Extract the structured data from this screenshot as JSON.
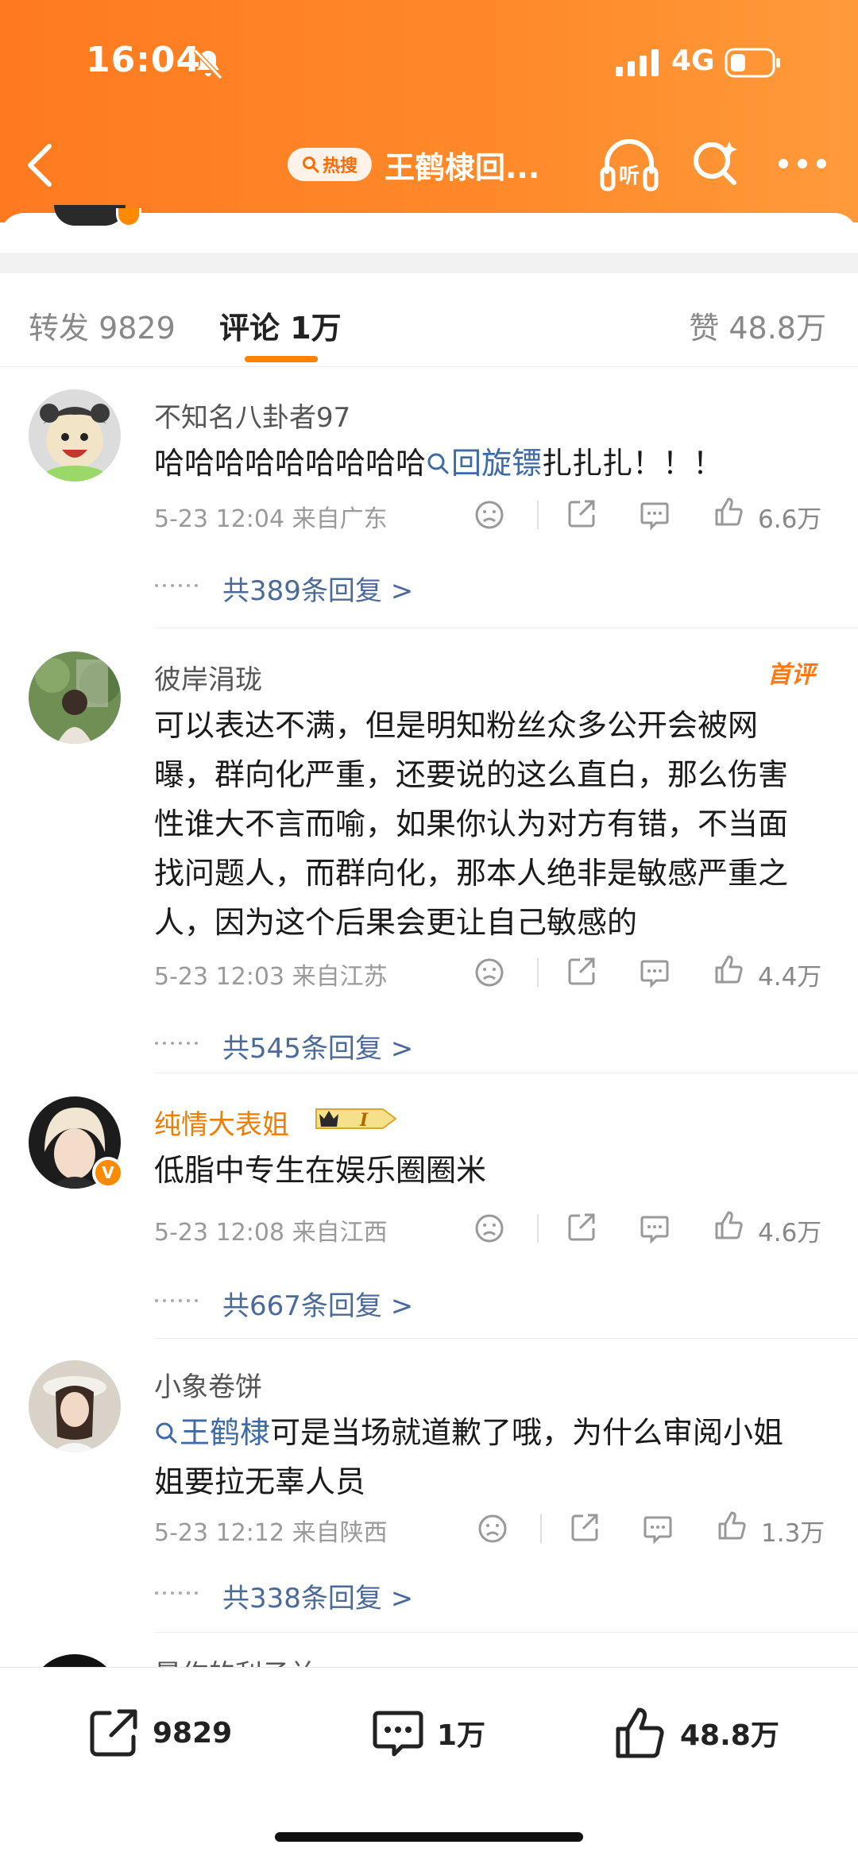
{
  "status_bar": {
    "time": "16:04",
    "network": "4G"
  },
  "nav": {
    "hot_tag": "热搜",
    "title": "王鹤棣回...",
    "listen_label": "听"
  },
  "tabs": {
    "repost": "转发 9829",
    "comment": "评论 1万",
    "likes": "赞 48.8万"
  },
  "comments": [
    {
      "username": "不知名八卦者97",
      "text_before": "哈哈哈哈哈哈哈哈哈",
      "topic": "回旋镖",
      "text_after": "扎扎扎！！！",
      "time": "5-23 12:04",
      "location": "来自广东",
      "likes": "6.6万",
      "replies": "共389条回复 >"
    },
    {
      "username": "彼岸涓珑",
      "tag": "首评",
      "text": "可以表达不满，但是明知粉丝众多公开会被网曝，群向化严重，还要说的这么直白，那么伤害性谁大不言而喻，如果你认为对方有错，不当面找问题人，而群向化，那本人绝非是敏感严重之人，因为这个后果会更让自己敏感的",
      "time": "5-23 12:03",
      "location": "来自江苏",
      "likes": "4.4万",
      "replies": "共545条回复 >"
    },
    {
      "username": "纯情大表姐",
      "vip_level": "I",
      "text": "低脂中专生在娱乐圈圈米",
      "time": "5-23 12:08",
      "location": "来自江西",
      "likes": "4.6万",
      "replies": "共667条回复 >"
    },
    {
      "username": "小象卷饼",
      "topic": "王鹤棣",
      "text_after": "可是当场就道歉了哦，为什么审阅小姐姐要拉无辜人员",
      "time": "5-23 12:12",
      "location": "来自陕西",
      "likes": "1.3万",
      "replies": "共338条回复 >"
    },
    {
      "username": "晨作的利子兰"
    }
  ],
  "bottom_bar": {
    "repost": "9829",
    "comment": "1万",
    "like": "48.8万"
  },
  "colors": {
    "accent": "#ff8200",
    "link": "#3e6aa8",
    "vip_name": "#f07c00"
  },
  "icons": [
    "back-icon",
    "search-icon",
    "listen-icon",
    "more-icon",
    "sad-face-icon",
    "share-icon",
    "comment-icon",
    "thumb-up-icon"
  ]
}
